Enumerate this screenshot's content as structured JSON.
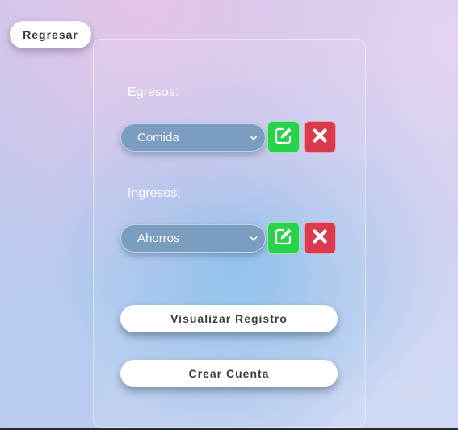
{
  "header": {
    "back_label": "Regresar"
  },
  "expenses": {
    "label": "Egresos:",
    "selected": "Comida"
  },
  "income": {
    "label": "Ingresos:",
    "selected": "Ahorros"
  },
  "actions": {
    "visualize_label": "Visualizar Registro",
    "create_label": "Crear Cuenta"
  },
  "colors": {
    "edit_button": "#29d24b",
    "delete_button": "#db3a4c",
    "select_fill": "#7a9dc0"
  },
  "icons": {
    "edit": "pencil-square-icon",
    "delete": "x-mark-icon",
    "dropdown": "chevron-down-icon"
  }
}
